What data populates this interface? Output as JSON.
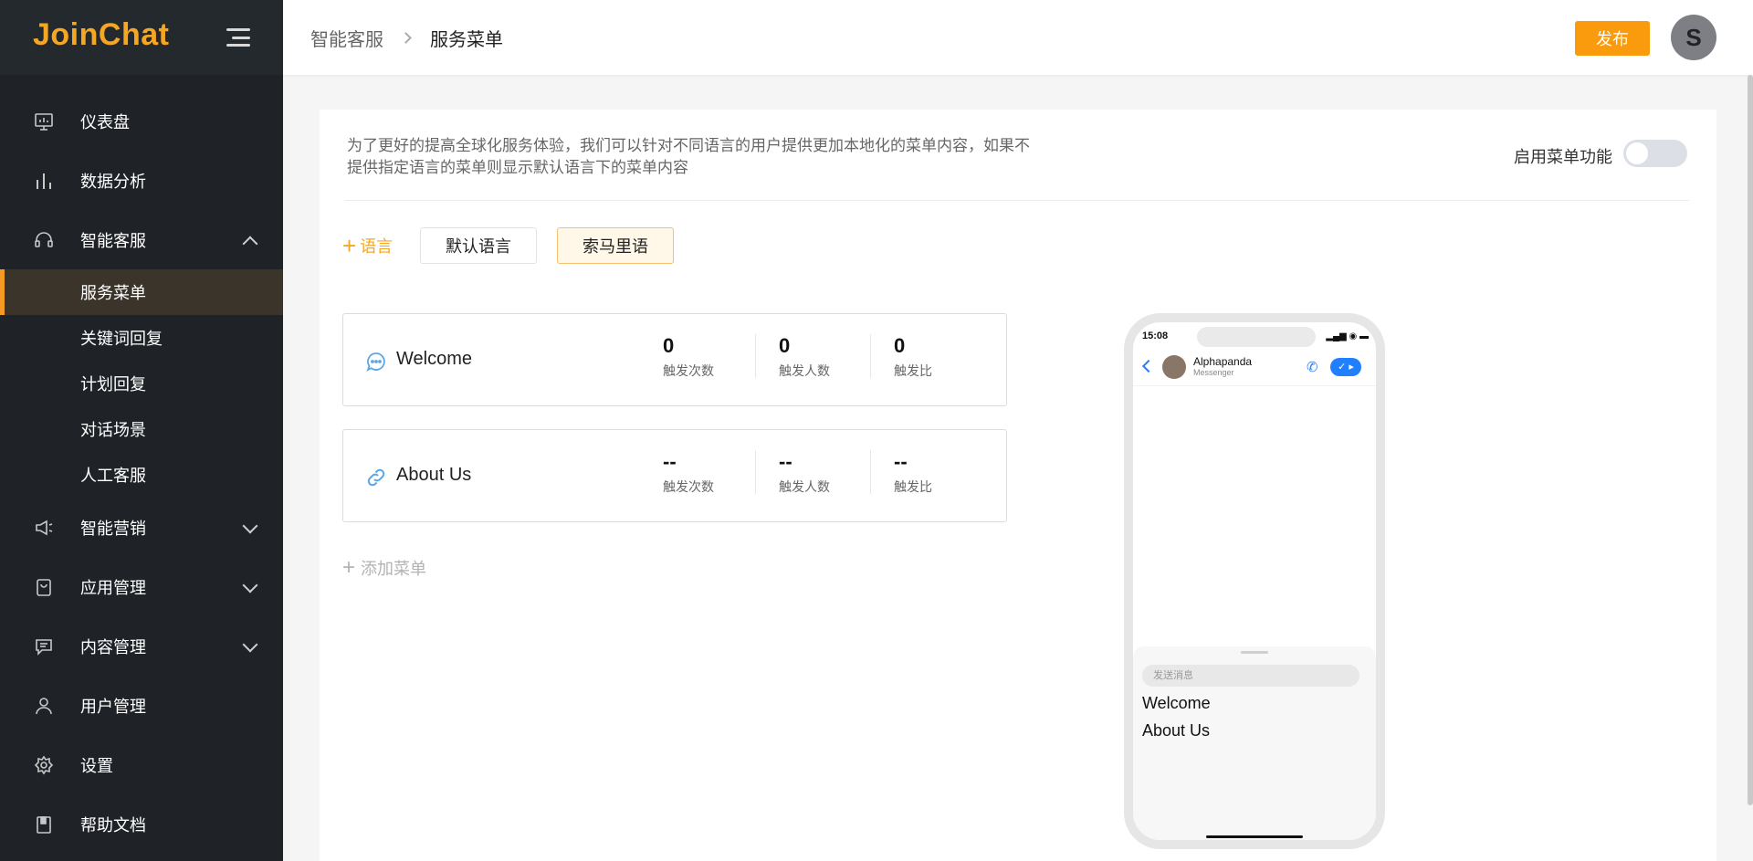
{
  "brand": {
    "logo_text": "JoinChat",
    "accent": "#fa9a0d"
  },
  "sidebar": {
    "items": [
      {
        "label": "仪表盘",
        "icon": "dashboard-icon"
      },
      {
        "label": "数据分析",
        "icon": "bar-chart-icon"
      },
      {
        "label": "智能客服",
        "icon": "headset-icon",
        "expanded": true,
        "children": [
          {
            "label": "服务菜单",
            "active": true
          },
          {
            "label": "关键词回复"
          },
          {
            "label": "计划回复"
          },
          {
            "label": "对话场景"
          },
          {
            "label": "人工客服"
          }
        ]
      },
      {
        "label": "智能营销",
        "icon": "megaphone-icon"
      },
      {
        "label": "应用管理",
        "icon": "app-icon"
      },
      {
        "label": "内容管理",
        "icon": "message-icon"
      },
      {
        "label": "用户管理",
        "icon": "user-icon"
      },
      {
        "label": "设置",
        "icon": "gear-icon"
      },
      {
        "label": "帮助文档",
        "icon": "book-icon"
      }
    ]
  },
  "header": {
    "breadcrumb": [
      "智能客服",
      "服务菜单"
    ],
    "publish_label": "发布",
    "avatar_letter": "S"
  },
  "main": {
    "description": "为了更好的提高全球化服务体验，我们可以针对不同语言的用户提供更加本地化的菜单内容，如果不提供指定语言的菜单则显示默认语言下的菜单内容",
    "toggle_label": "启用菜单功能",
    "toggle_on": false,
    "add_language_label": "语言",
    "languages": [
      {
        "label": "默认语言",
        "active": false
      },
      {
        "label": "索马里语",
        "active": true
      }
    ],
    "menus": [
      {
        "title": "Welcome",
        "icon": "chat-bubble-icon",
        "stats": [
          {
            "value": "0",
            "label": "触发次数"
          },
          {
            "value": "0",
            "label": "触发人数"
          },
          {
            "value": "0",
            "label": "触发比"
          }
        ]
      },
      {
        "title": "About Us",
        "icon": "link-icon",
        "stats": [
          {
            "value": "--",
            "label": "触发次数"
          },
          {
            "value": "--",
            "label": "触发人数"
          },
          {
            "value": "--",
            "label": "触发比"
          }
        ]
      }
    ],
    "add_menu_label": "添加菜单"
  },
  "phone": {
    "time": "15:08",
    "contact_name": "Alphapanda",
    "contact_sub": "Messenger",
    "input_placeholder": "发送消息",
    "menu_items": [
      "Welcome",
      "About Us"
    ]
  }
}
